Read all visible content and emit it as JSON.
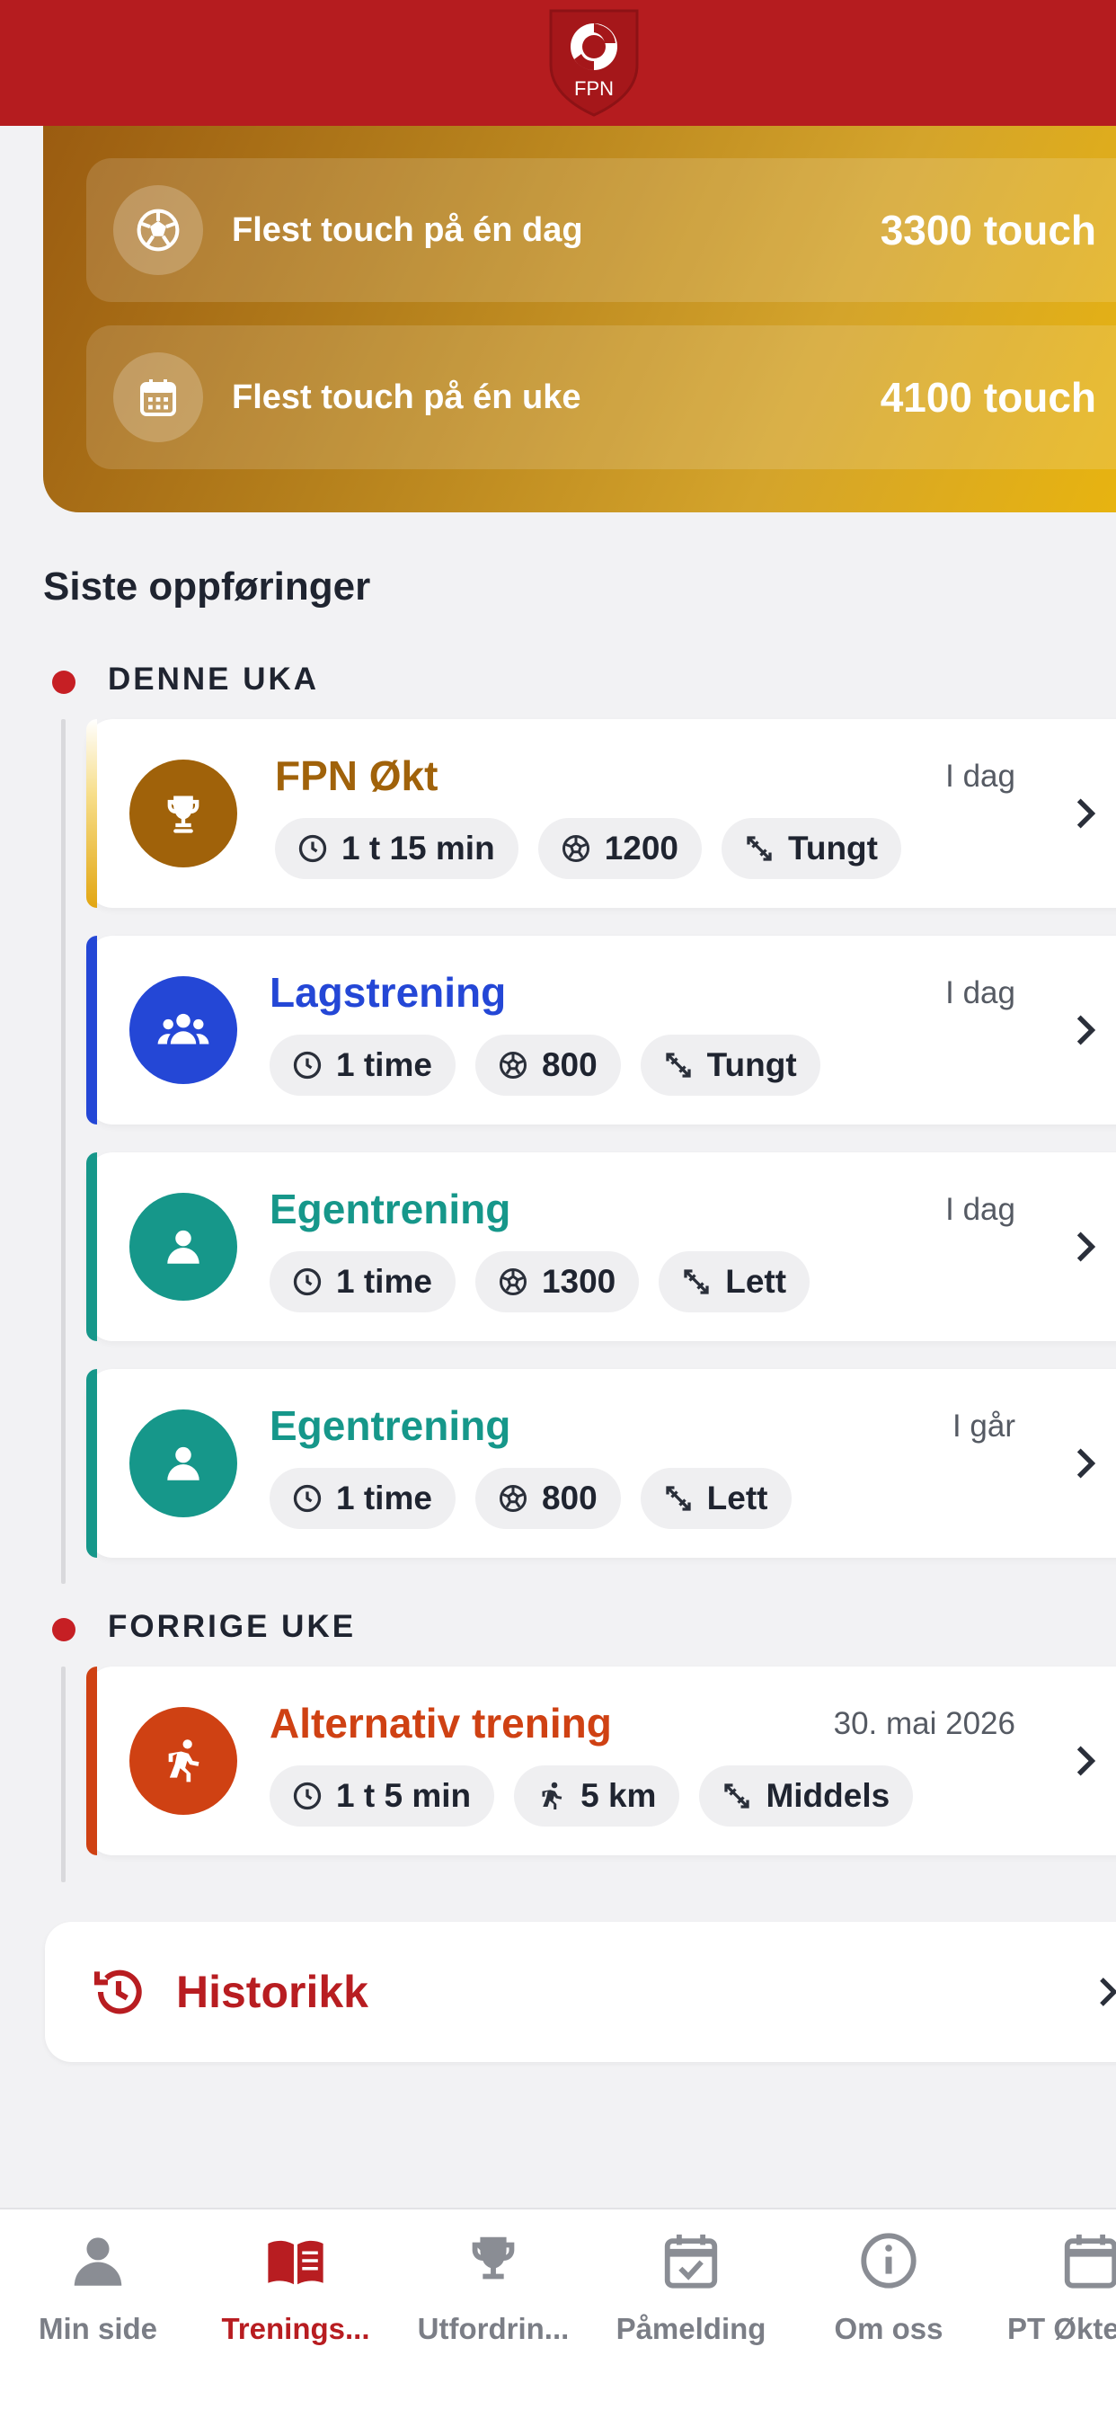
{
  "header": {
    "logo_text": "FPN"
  },
  "stats": [
    {
      "icon": "soccer-ball-icon",
      "label": "Flest touch på én dag",
      "value": "3300 touch"
    },
    {
      "icon": "calendar-icon",
      "label": "Flest touch på én uke",
      "value": "4100 touch"
    }
  ],
  "section_title": "Siste oppføringer",
  "groups": [
    {
      "label": "DENNE UKA",
      "entries": [
        {
          "title": "FPN Økt",
          "date": "I dag",
          "icon": "trophy-icon",
          "color": "#a0620a",
          "chips": [
            {
              "icon": "clock-icon",
              "text": "1 t 15 min"
            },
            {
              "icon": "ball-icon",
              "text": "1200"
            },
            {
              "icon": "intensity-icon",
              "text": "Tungt"
            }
          ]
        },
        {
          "title": "Lagstrening",
          "date": "I dag",
          "icon": "group-icon",
          "color": "#2447d6",
          "chips": [
            {
              "icon": "clock-icon",
              "text": "1 time"
            },
            {
              "icon": "ball-icon",
              "text": "800"
            },
            {
              "icon": "intensity-icon",
              "text": "Tungt"
            }
          ]
        },
        {
          "title": "Egentrening",
          "date": "I dag",
          "icon": "person-icon",
          "color": "#16978a",
          "chips": [
            {
              "icon": "clock-icon",
              "text": "1 time"
            },
            {
              "icon": "ball-icon",
              "text": "1300"
            },
            {
              "icon": "intensity-icon",
              "text": "Lett"
            }
          ]
        },
        {
          "title": "Egentrening",
          "date": "I går",
          "icon": "person-icon",
          "color": "#16978a",
          "chips": [
            {
              "icon": "clock-icon",
              "text": "1 time"
            },
            {
              "icon": "ball-icon",
              "text": "800"
            },
            {
              "icon": "intensity-icon",
              "text": "Lett"
            }
          ]
        }
      ]
    },
    {
      "label": "FORRIGE UKE",
      "entries": [
        {
          "title": "Alternativ trening",
          "date": "30. mai 2026",
          "icon": "runner-icon",
          "color": "#cf4113",
          "chips": [
            {
              "icon": "clock-icon",
              "text": "1 t 5 min"
            },
            {
              "icon": "runner-icon",
              "text": "5 km"
            },
            {
              "icon": "intensity-icon",
              "text": "Middels"
            }
          ]
        }
      ]
    }
  ],
  "history": {
    "label": "Historikk"
  },
  "tabs": [
    {
      "label": "Min side",
      "icon": "person-icon",
      "active": false
    },
    {
      "label": "Trenings...",
      "icon": "book-icon",
      "active": true
    },
    {
      "label": "Utfordrin...",
      "icon": "trophy-icon",
      "active": false
    },
    {
      "label": "Påmelding",
      "icon": "calendar-check-icon",
      "active": false
    },
    {
      "label": "Om oss",
      "icon": "info-icon",
      "active": false
    },
    {
      "label": "PT Økter",
      "icon": "calendar-icon",
      "active": false
    }
  ],
  "colors": {
    "brand_red": "#b51c1f",
    "gold": "#d4a42b"
  }
}
